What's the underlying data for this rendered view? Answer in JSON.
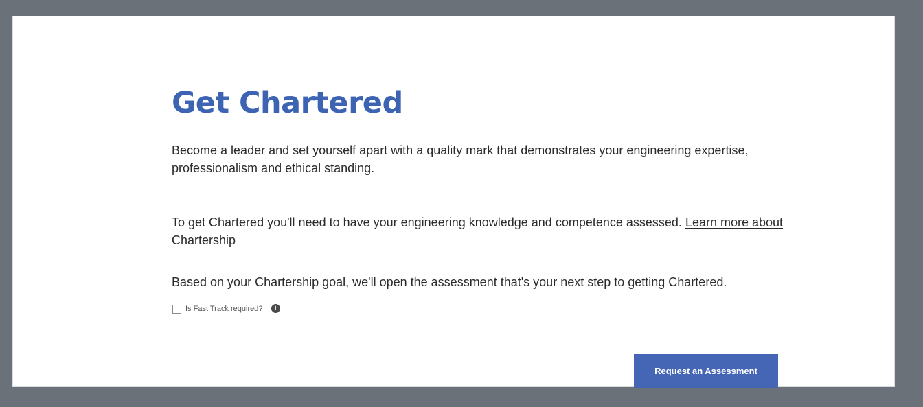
{
  "page": {
    "title": "Get Chartered"
  },
  "intro": {
    "text": "Become a leader and set yourself apart with a quality mark that demonstrates your engineering expertise, professionalism and ethical standing."
  },
  "assessment_info": {
    "text": "To get Chartered you'll need to have your engineering knowledge and competence assessed. ",
    "link_label": "Learn more about Chartership"
  },
  "goal_info": {
    "text_before": "Based on your ",
    "link_label": "Chartership goal",
    "text_after": ", we'll open the assessment that's your next step to getting Chartered."
  },
  "fast_track": {
    "label": "Is Fast Track required?",
    "checked": false,
    "info_icon": "info-icon",
    "info_glyph": "i"
  },
  "actions": {
    "request_label": "Request an Assessment"
  },
  "colors": {
    "background": "#6b7179",
    "panel": "#ffffff",
    "accent": "#3d63b3",
    "button": "#4566b5",
    "text": "#2b2b2b"
  }
}
